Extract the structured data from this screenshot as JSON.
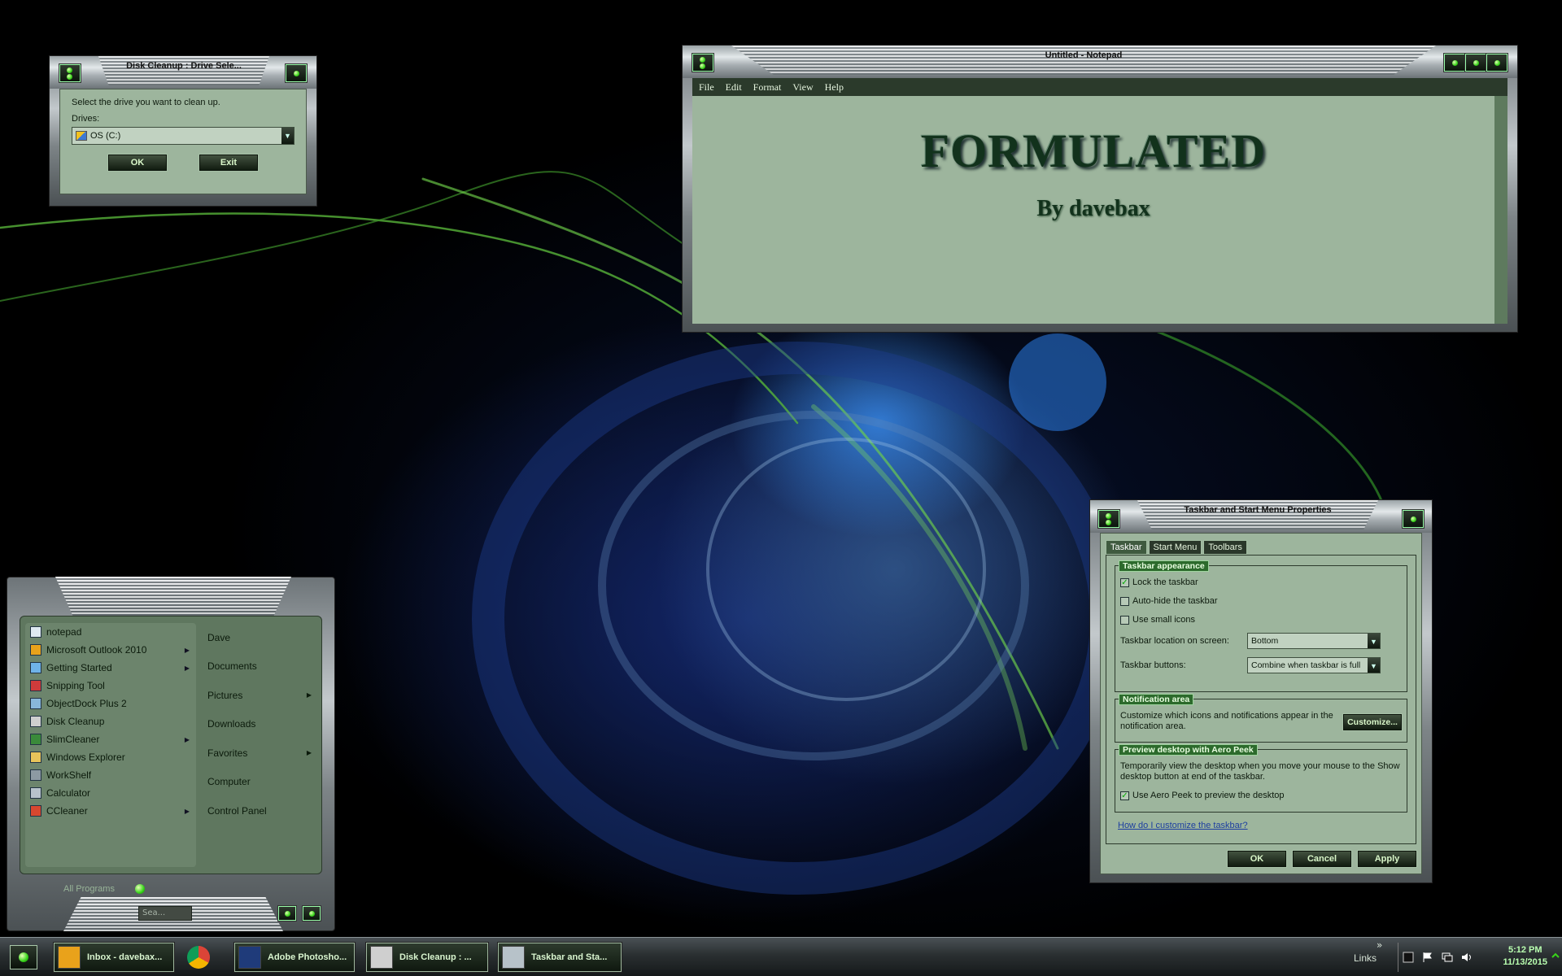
{
  "colors": {
    "panel_green": "#9db59d",
    "led_green": "#39d41a",
    "dark_green": "#12321c",
    "clock_green": "#b9ffb0"
  },
  "disk_cleanup": {
    "title": "Disk Cleanup : Drive Sele...",
    "prompt": "Select the drive you want to clean up.",
    "drives_label": "Drives:",
    "selected_drive": "OS (C:)",
    "ok": "OK",
    "exit": "Exit"
  },
  "notepad": {
    "title": "Untitled - Notepad",
    "menu": [
      "File",
      "Edit",
      "Format",
      "View",
      "Help"
    ],
    "heading": "FORMULATED",
    "byline": "By davebax"
  },
  "taskbar_props": {
    "title": "Taskbar and Start Menu Properties",
    "tabs": [
      "Taskbar",
      "Start Menu",
      "Toolbars"
    ],
    "appearance_group": "Taskbar appearance",
    "lock": "Lock the taskbar",
    "autohide": "Auto-hide the taskbar",
    "small_icons": "Use small icons",
    "location_label": "Taskbar location on screen:",
    "location_value": "Bottom",
    "buttons_label": "Taskbar buttons:",
    "buttons_value": "Combine when taskbar is full",
    "notification_group": "Notification area",
    "notification_text": "Customize which icons and notifications appear in the notification area.",
    "customize": "Customize...",
    "peek_group": "Preview desktop with Aero Peek",
    "peek_text": "Temporarily view the desktop when you move your mouse to the Show desktop button at end of the taskbar.",
    "peek_check": "Use Aero Peek to preview the desktop",
    "help_link": "How do I customize the taskbar?",
    "ok": "OK",
    "cancel": "Cancel",
    "apply": "Apply",
    "checked": {
      "lock": true,
      "autohide": false,
      "small_icons": false,
      "peek": true
    }
  },
  "start_menu": {
    "programs": [
      {
        "label": "notepad",
        "icon": "notepad-icon",
        "submenu": false
      },
      {
        "label": "Microsoft Outlook 2010",
        "icon": "outlook-icon",
        "submenu": true
      },
      {
        "label": "Getting Started",
        "icon": "getting-started-icon",
        "submenu": true
      },
      {
        "label": "Snipping Tool",
        "icon": "scissors-icon",
        "submenu": false
      },
      {
        "label": "ObjectDock Plus 2",
        "icon": "objectdock-icon",
        "submenu": false
      },
      {
        "label": "Disk Cleanup",
        "icon": "disk-cleanup-icon",
        "submenu": false
      },
      {
        "label": "SlimCleaner",
        "icon": "slimcleaner-icon",
        "submenu": true
      },
      {
        "label": "Windows Explorer",
        "icon": "folder-icon",
        "submenu": false
      },
      {
        "label": "WorkShelf",
        "icon": "workshelf-icon",
        "submenu": false
      },
      {
        "label": "Calculator",
        "icon": "calculator-icon",
        "submenu": false
      },
      {
        "label": "CCleaner",
        "icon": "ccleaner-icon",
        "submenu": true
      }
    ],
    "places": [
      {
        "label": "Dave",
        "submenu": false
      },
      {
        "label": "Documents",
        "submenu": false
      },
      {
        "label": "Pictures",
        "submenu": true
      },
      {
        "label": "Downloads",
        "submenu": false
      },
      {
        "label": "Favorites",
        "submenu": true
      },
      {
        "label": "Computer",
        "submenu": false
      },
      {
        "label": "Control Panel",
        "submenu": false
      }
    ],
    "all_programs": "All Programs",
    "search_placeholder": "Sea..."
  },
  "taskbar": {
    "tasks": [
      {
        "label": "Inbox - davebax...",
        "icon": "outlook-icon"
      },
      {
        "label": "",
        "icon": "chrome-icon"
      },
      {
        "label": "Adobe Photosho...",
        "icon": "photoshop-icon"
      },
      {
        "label": "Disk Cleanup : ...",
        "icon": "disk-cleanup-icon"
      },
      {
        "label": "Taskbar and Sta...",
        "icon": "taskbar-props-icon"
      }
    ],
    "links": "Links",
    "chevron": "»",
    "time": "5:12 PM",
    "date": "11/13/2015"
  }
}
